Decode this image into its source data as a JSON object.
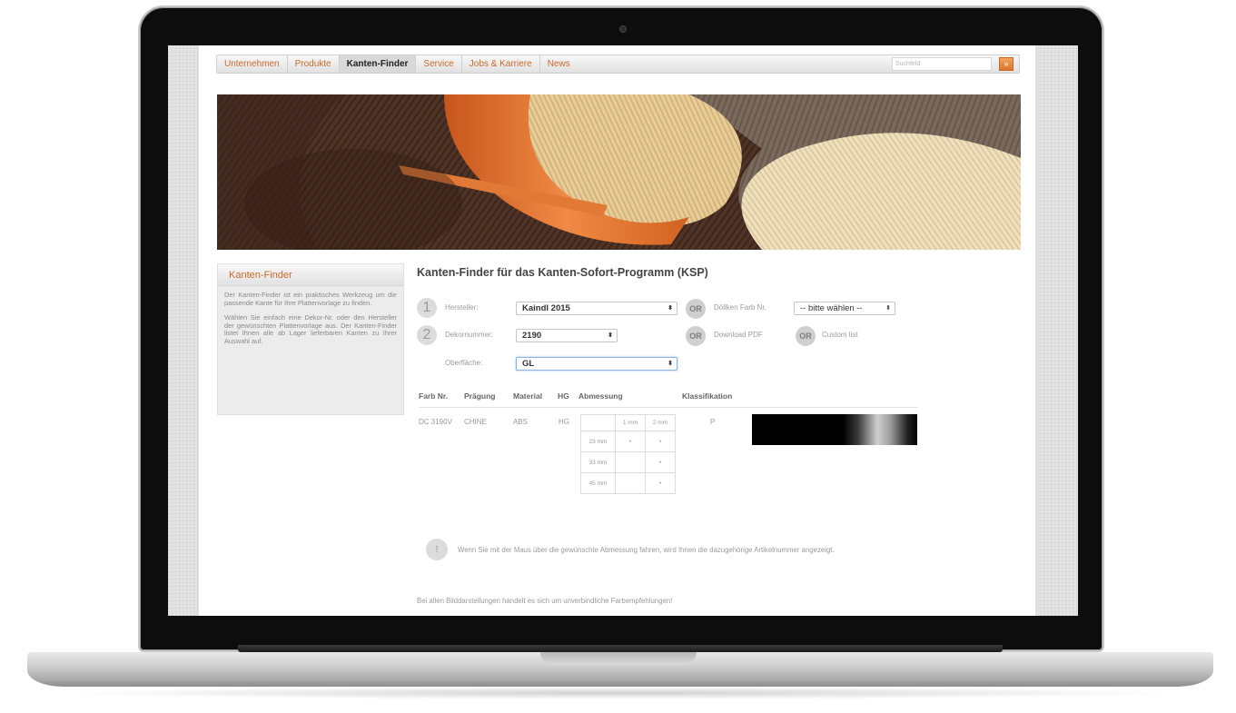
{
  "nav": {
    "items": [
      "Unternehmen",
      "Produkte",
      "Kanten-Finder",
      "Service",
      "Jobs & Karriere",
      "News"
    ],
    "active": "Kanten-Finder",
    "search_placeholder": "Suchfeld",
    "search_button": "»"
  },
  "sidebar": {
    "title": "Kanten-Finder",
    "paragraphs": [
      "Der Kanten-Finder ist ein praktisches Werkzeug um die passende Kante für Ihre Plattenvorlage zu finden.",
      "Wählen Sie einfach eine Dekor-Nr. oder den Hersteller der gewünschten Plattenvorlage aus. Der Kanten-Finder listet Ihnen alle ab Lager lieferbaren Kanten zu Ihrer Auswahl auf."
    ]
  },
  "main": {
    "title": "Kanten-Finder für das Kanten-Sofort-Programm (KSP)",
    "step1": "1",
    "step2": "2",
    "or_label": "OR",
    "hersteller_label": "Hersteller:",
    "hersteller_value": "Kaindl 2015",
    "dekor_label": "Dekornummer:",
    "dekor_value": "2190",
    "oberflaeche_label": "Oberfläche:",
    "oberflaeche_value": "GL",
    "farb_label": "Döllken Farb Nr.",
    "farb_value": "-- bitte wählen --",
    "download_pdf": "Download PDF",
    "custom_list": "Custom list"
  },
  "table": {
    "headers": [
      "Farb Nr.",
      "Prägung",
      "Material",
      "HG",
      "Abmessung",
      "Klassifikation"
    ],
    "row": {
      "farb_nr": "DC 3190V",
      "praegung": "CHINE",
      "material": "ABS",
      "hg": "HG",
      "klassifikation": "P"
    },
    "dimensions": {
      "col_headers": [
        "",
        "1 mm",
        "2 mm"
      ],
      "rows": [
        {
          "label": "23 mm",
          "c1": "•",
          "c2": "•"
        },
        {
          "label": "33 mm",
          "c1": "",
          "c2": "•"
        },
        {
          "label": "45 mm",
          "c1": "",
          "c2": "•"
        }
      ]
    }
  },
  "info": {
    "icon": "!",
    "text": "Wenn Sie mit der Maus über die gewünschte Abmessung fahren, wird Ihnen die dazugehörige Artikelnummer angezeigt."
  },
  "footer_note": "Bei allen Bilddarstellungen handelt es sich um unverbindliche Farbempfehlungen!",
  "colors": {
    "accent": "#c96a2a",
    "search_button": "#e8893f"
  }
}
